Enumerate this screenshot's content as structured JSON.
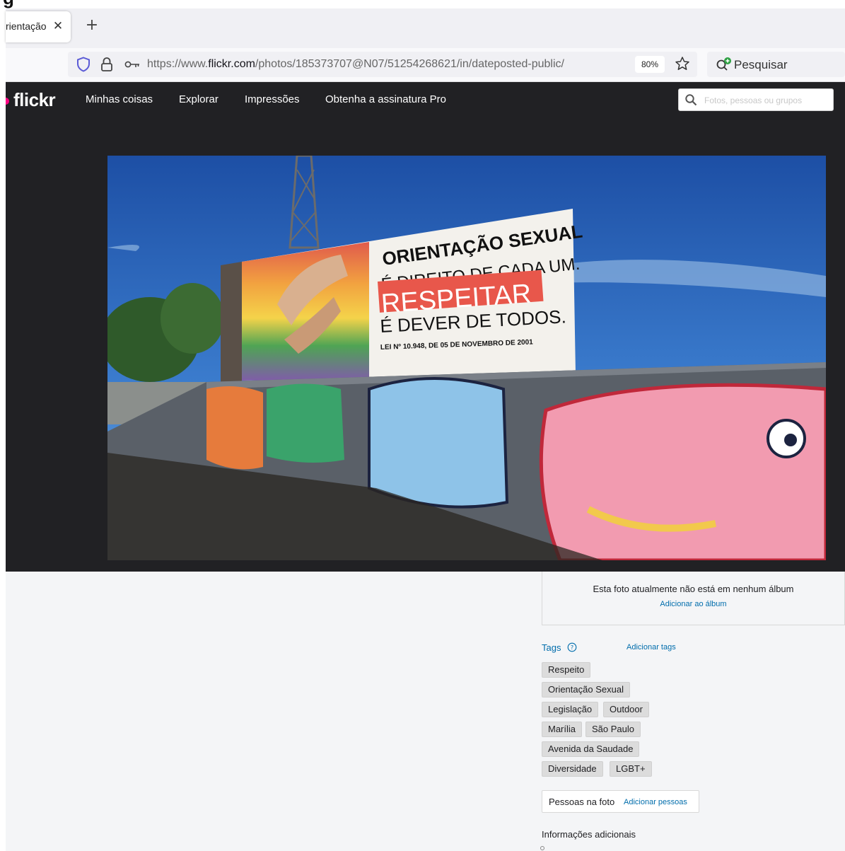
{
  "browser": {
    "tab": {
      "title": "rientação",
      "close_glyph": "✕"
    },
    "new_tab_glyph": "+",
    "url": {
      "prefix": "https://www.",
      "domain": "flickr.com",
      "path": "/photos/185373707@N07/51254268621/in/dateposted-public/"
    },
    "zoom": "80%",
    "search_label": "Pesquisar"
  },
  "flickr": {
    "logo": "flickr",
    "nav": [
      "Minhas coisas",
      "Explorar",
      "Impressões",
      "Obtenha a assinatura Pro"
    ],
    "search_placeholder": "Fotos, pessoas ou grupos"
  },
  "photo": {
    "billboard": {
      "line1": "ORIENTAÇÃO SEXUAL",
      "line2": "É DIREITO DE CADA UM.",
      "line3": "RESPEITAR",
      "line4": "É DEVER DE TODOS.",
      "law": "LEI Nº 10.948, DE 05 DE NOVEMBRO DE 2001"
    }
  },
  "sidebar": {
    "album_message": "Esta foto atualmente não está em nenhum álbum",
    "album_link": "Adicionar ao álbum",
    "tags_heading": "Tags",
    "add_tags": "Adicionar tags",
    "tags": [
      "Respeito",
      "Orientação Sexual",
      "Legislação",
      "Outdoor",
      "Marília",
      "São Paulo",
      "Avenida da Saudade",
      "Diversidade",
      "LGBT+"
    ],
    "people_label": "Pessoas na foto",
    "people_link": "Adicionar pessoas",
    "more_info": "Informações adicionais"
  },
  "colors": {
    "flickr_dark": "#212124",
    "flickr_pink": "#ff0084",
    "link_blue": "#006dac"
  },
  "icons": [
    "shield-icon",
    "lock-icon",
    "key-icon",
    "star-icon",
    "search-icon",
    "help-icon",
    "close-icon",
    "plus-icon"
  ]
}
